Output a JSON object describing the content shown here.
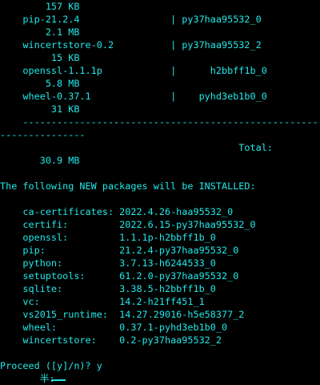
{
  "terminal": {
    "colors": {
      "background": "#000000",
      "text": "#22e8e8"
    },
    "lines": [
      "        157 KB",
      "    pip-21.2.4                | py37haa95532_0",
      "        2.1 MB",
      "    wincertstore-0.2          | py37haa95532_2",
      "         15 KB",
      "    openssl-1.1.1p            |      h2bbff1b_0",
      "        5.8 MB",
      "    wheel-0.37.1              |    pyhd3eb1b0_0",
      "         31 KB",
      "    ------------------------------------------------------------",
      "---------------",
      "                                          Total:",
      "       30.9 MB",
      "",
      "The following NEW packages will be INSTALLED:",
      "",
      "    ca-certificates: 2022.4.26-haa95532_0",
      "    certifi:         2022.6.15-py37haa95532_0",
      "    openssl:         1.1.1p-h2bbff1b_0",
      "    pip:             21.2.4-py37haa95532_0",
      "    python:          3.7.13-h6244533_0",
      "    setuptools:      61.2.0-py37haa95532_0",
      "    sqlite:          3.38.5-h2bbff1b_0",
      "    vc:              14.2-h21ff451_1",
      "    vs2015_runtime:  14.27.29016-h5e58377_2",
      "    wheel:           0.37.1-pyhd3eb1b0_0",
      "    wincertstore:    0.2-py37haa95532_2",
      "",
      "Proceed ([y]/n)? y",
      "       半:"
    ]
  }
}
